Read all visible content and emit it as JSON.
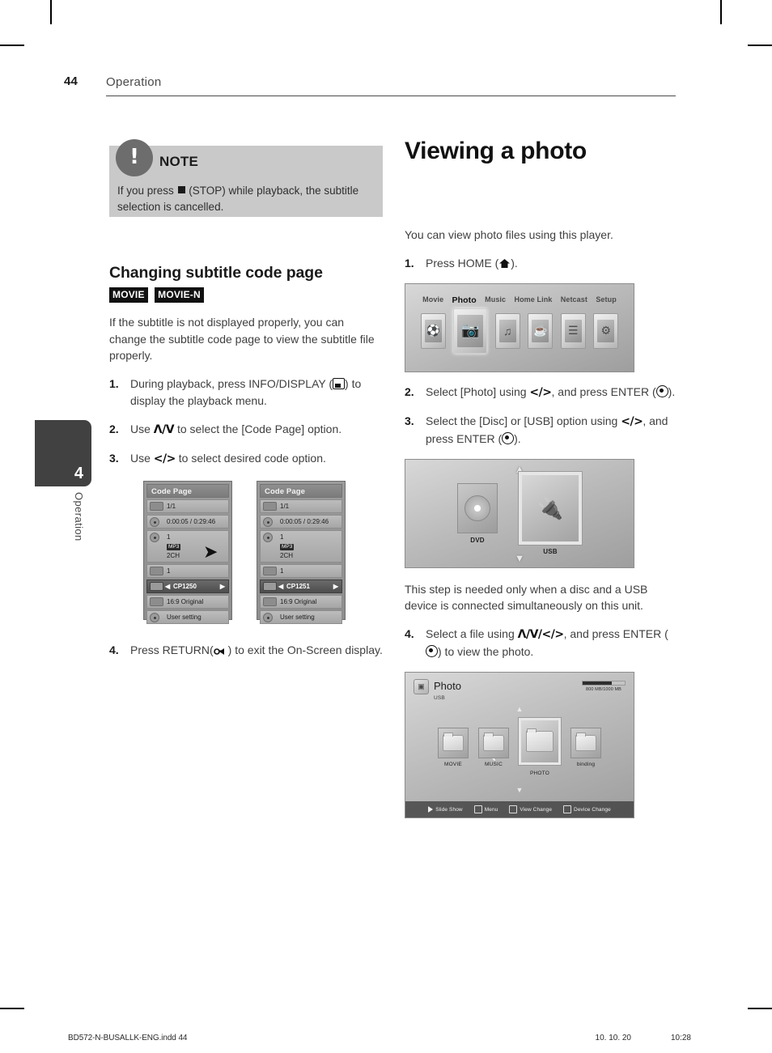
{
  "header": {
    "page_number": "44",
    "section": "Operation"
  },
  "side_tab": {
    "number": "4",
    "label": "Operation"
  },
  "note": {
    "icon": "exclamation-icon",
    "title": "NOTE",
    "body_before": "If you press ",
    "body_after": " (STOP) while playback, the subtitle selection is cancelled."
  },
  "left_column": {
    "heading": "Changing subtitle code page",
    "badges": [
      "MOVIE",
      "MOVIE-N"
    ],
    "intro": "If the subtitle is not displayed properly, you can change the subtitle code page to view the subtitle file properly.",
    "steps": [
      {
        "n": "1.",
        "a": "During playback, press INFO/DISPLAY (",
        "b": ") to display the playback menu.",
        "glyph": "info-display-icon"
      },
      {
        "n": "2.",
        "a": "Use ",
        "key": "Λ/V",
        "b": " to select the [Code Page] option."
      },
      {
        "n": "3.",
        "a": "Use ",
        "key": "</>",
        "b": " to select desired code option."
      },
      {
        "n": "4.",
        "a": "Press RETURN(",
        "b": ") to exit the On-Screen display.",
        "glyph": "return-icon"
      }
    ],
    "osd_left": {
      "title": "Code Page",
      "rows": [
        {
          "icon": "title-icon",
          "text": "1/1"
        },
        {
          "icon": "time-icon",
          "text": "0:00:05 / 0:29:46"
        },
        {
          "icon": "audio-icon",
          "line1": "1",
          "badge": "MP3",
          "line3": "2CH"
        },
        {
          "icon": "subtitle-icon",
          "text": "1"
        },
        {
          "icon": "codepage-icon",
          "text": "CP1250",
          "selected": true
        },
        {
          "icon": "aspect-icon",
          "text": "16:9 Original"
        },
        {
          "icon": "picture-icon",
          "text": "User setting"
        }
      ]
    },
    "osd_right": {
      "title": "Code Page",
      "rows": [
        {
          "icon": "title-icon",
          "text": "1/1"
        },
        {
          "icon": "time-icon",
          "text": "0:00:05 / 0:29:46"
        },
        {
          "icon": "audio-icon",
          "line1": "1",
          "badge": "MP3",
          "line3": "2CH"
        },
        {
          "icon": "subtitle-icon",
          "text": "1"
        },
        {
          "icon": "codepage-icon",
          "text": "CP1251",
          "selected": true
        },
        {
          "icon": "aspect-icon",
          "text": "16:9 Original"
        },
        {
          "icon": "picture-icon",
          "text": "User setting"
        }
      ]
    },
    "osd_transition_icon": "right-arrow-icon"
  },
  "right_column": {
    "heading": "Viewing a photo",
    "intro": "You can view photo files using this player.",
    "steps": [
      {
        "n": "1.",
        "a": "Press HOME (",
        "b": ").",
        "glyph": "home-icon"
      },
      {
        "n": "2.",
        "a": "Select [Photo] using ",
        "key": "</>",
        "b": ", and press ENTER (",
        "c": ").",
        "glyph": "enter-icon"
      },
      {
        "n": "3.",
        "a": "Select the [Disc] or [USB] option using ",
        "key": "</>",
        "b": ", and press ENTER (",
        "c": ").",
        "glyph": "enter-icon"
      },
      {
        "n": "4.",
        "a": "Select a file using ",
        "key": "Λ/V/</>",
        "b": ", and press ENTER (",
        "c": ") to view the photo.",
        "glyph": "enter-icon"
      }
    ],
    "note_text": "This step is needed only when a disc and a USB device is connected simultaneously on this unit.",
    "home_screen": {
      "tabs": [
        "Movie",
        "Photo",
        "Music",
        "Home Link",
        "Netcast",
        "Setup"
      ],
      "active_tab": "Photo",
      "icons": [
        "movie-icon",
        "photo-icon",
        "music-icon",
        "home-link-icon",
        "netcast-icon",
        "setup-icon"
      ]
    },
    "device_screen": {
      "items": [
        {
          "label": "DVD",
          "icon": "disc-icon",
          "selected": false
        },
        {
          "label": "USB",
          "icon": "usb-icon",
          "selected": true
        }
      ],
      "nav": {
        "up": "▲",
        "down": "▼",
        "left": "❮",
        "right": "❯"
      }
    },
    "browser_screen": {
      "title": "Photo",
      "source": "USB",
      "storage": "800 MB/1000 MB",
      "folders": [
        {
          "label": "MOVIE",
          "selected": false
        },
        {
          "label": "MUSIC",
          "selected": false
        },
        {
          "label": "PHOTO",
          "selected": true
        },
        {
          "label": "binding",
          "selected": false
        }
      ],
      "bottom_bar": [
        {
          "icon": "play-icon",
          "label": "Slide Show"
        },
        {
          "icon": "menu-icon",
          "label": "Menu"
        },
        {
          "icon": "view-icon",
          "label": "View Change"
        },
        {
          "icon": "device-icon",
          "label": "Device Change"
        }
      ]
    }
  },
  "footer": {
    "filename": "BD572-N-BUSALLK-ENG.indd   44",
    "date": "10. 10. 20",
    "time": "10:28"
  }
}
